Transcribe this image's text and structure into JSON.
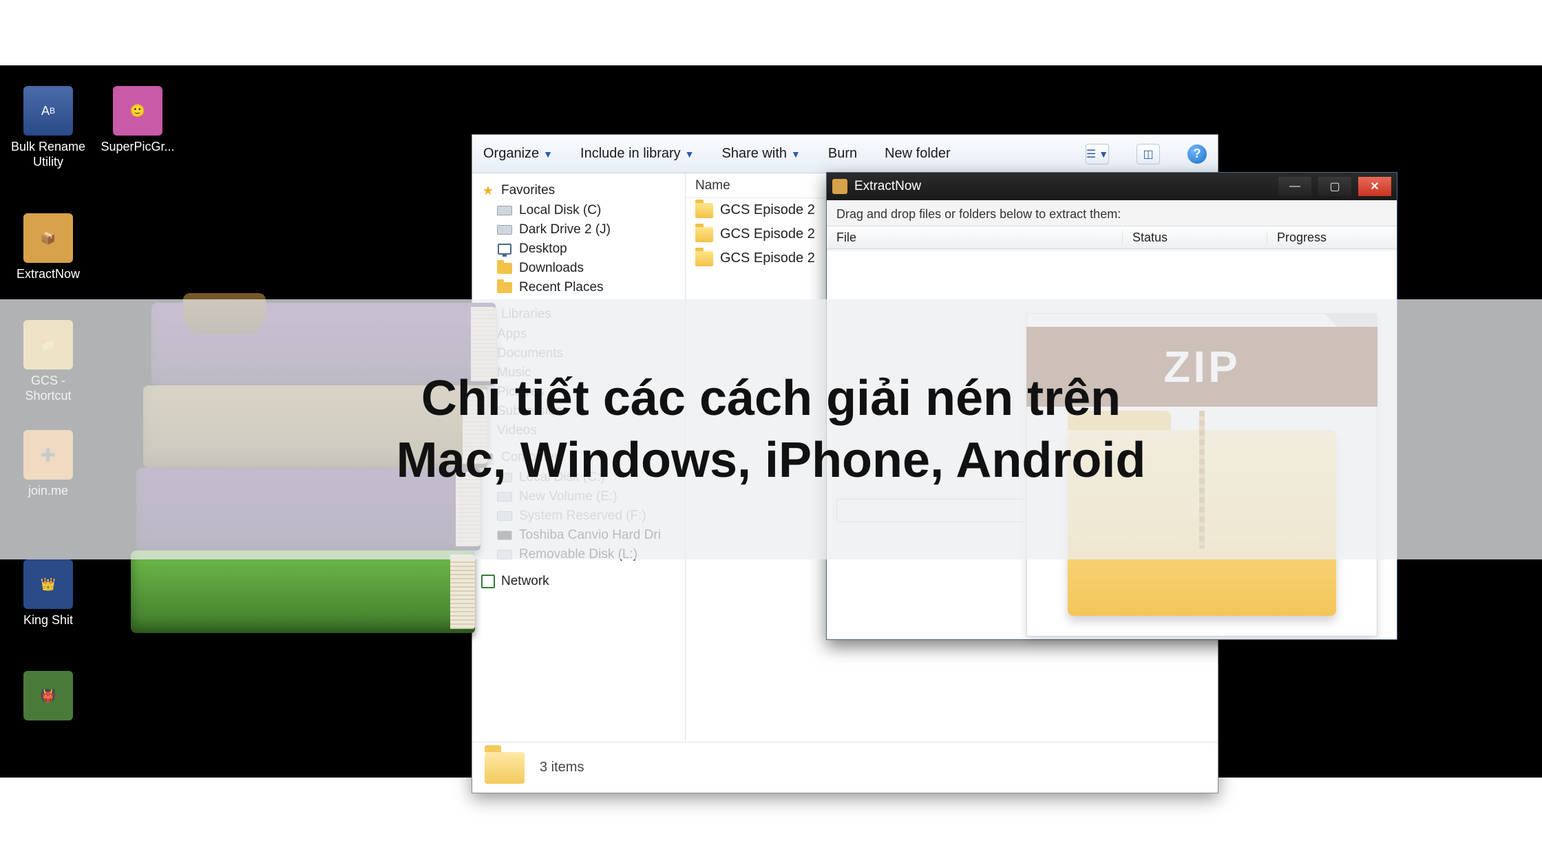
{
  "desktop_icons": [
    {
      "name": "bulk-rename",
      "label": "Bulk Rename Utility"
    },
    {
      "name": "superpicgr",
      "label": "SuperPicGr..."
    },
    {
      "name": "extractnow",
      "label": "ExtractNow"
    },
    {
      "name": "gcs-shortcut",
      "label": "GCS - Shortcut"
    },
    {
      "name": "joinme",
      "label": "join.me"
    },
    {
      "name": "king-shit",
      "label": "King Shit"
    },
    {
      "name": "orc",
      "label": ""
    }
  ],
  "explorer": {
    "toolbar": {
      "organize": "Organize",
      "include": "Include in library",
      "share": "Share with",
      "burn": "Burn",
      "newfolder": "New folder"
    },
    "list_header": "Name",
    "nav": {
      "favorites": "Favorites",
      "fav_items": [
        {
          "label": "Local Disk (C)",
          "icon": "drive"
        },
        {
          "label": "Dark Drive 2 (J)",
          "icon": "drive"
        },
        {
          "label": "Desktop",
          "icon": "monitor"
        },
        {
          "label": "Downloads",
          "icon": "folderic"
        },
        {
          "label": "Recent Places",
          "icon": "folderic"
        }
      ],
      "libraries": "Libraries",
      "lib_items": [
        "Apps",
        "Documents",
        "Music",
        "Pictures",
        "Subversion",
        "Videos"
      ],
      "computer": "Computer",
      "comp_items": [
        "Local Disk (C:)",
        "New Volume (E:)",
        "System Reserved (F:)",
        "Toshiba Canvio Hard Dri",
        "Removable Disk (L:)"
      ],
      "network": "Network"
    },
    "files": [
      "GCS Episode 2",
      "GCS Episode 2",
      "GCS Episode 2"
    ],
    "status": "3 items"
  },
  "extractnow": {
    "title": "ExtractNow",
    "hint": "Drag and drop files or folders below to extract them:",
    "cols": {
      "file": "File",
      "status": "Status",
      "progress": "Progress"
    }
  },
  "zip": {
    "label": "ZIP"
  },
  "overlay": {
    "line1": "Chi tiết các cách giải nén trên",
    "line2": "Mac, Windows, iPhone, Android"
  }
}
